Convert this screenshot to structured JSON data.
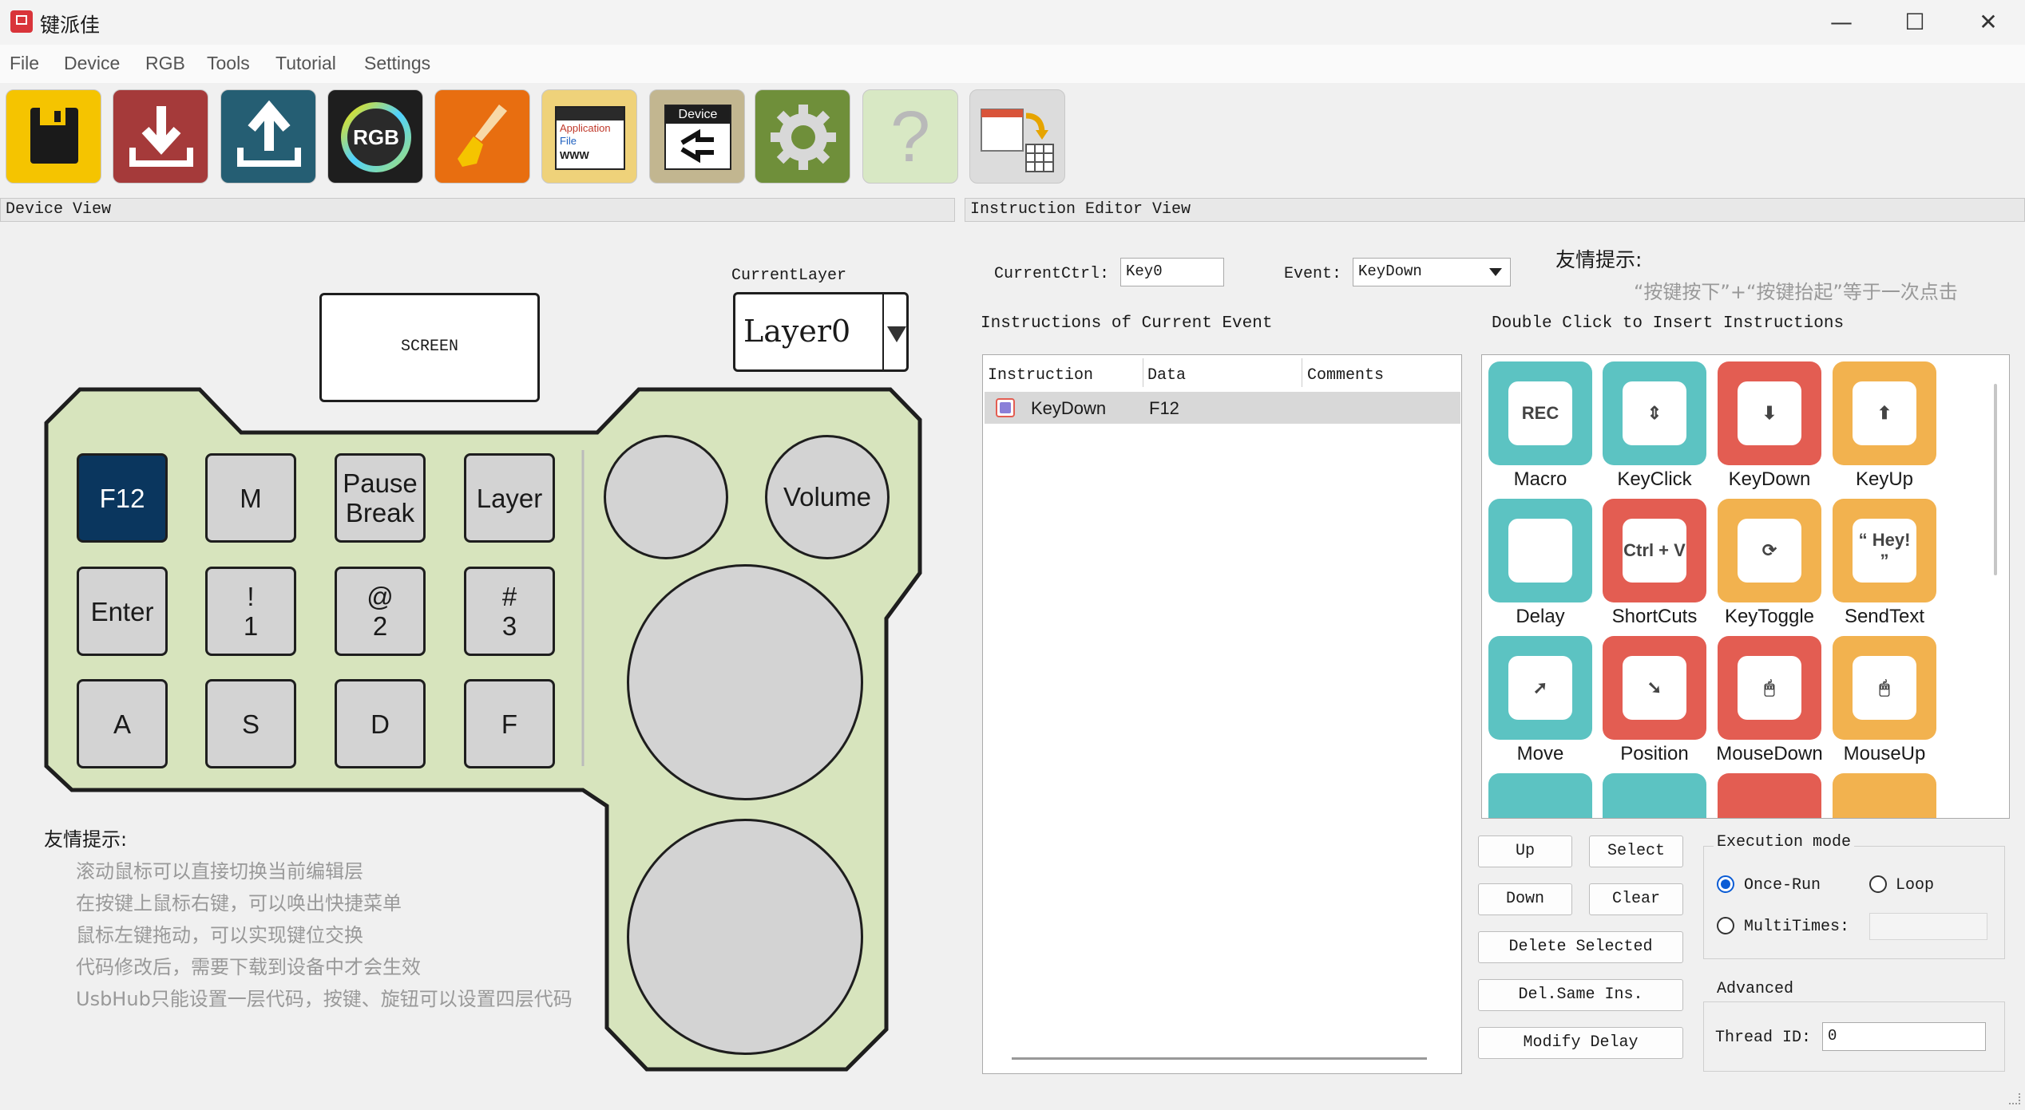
{
  "window": {
    "title": "键派佳",
    "minimize": "—",
    "maximize": "☐",
    "close": "✕"
  },
  "menu": [
    "File",
    "Device",
    "RGB",
    "Tools",
    "Tutorial",
    "Settings"
  ],
  "toolbar": {
    "rgb_label": "RGB",
    "app_icon_text": [
      "Application",
      "File",
      "WWW"
    ],
    "device_label": "Device",
    "help_label": "?",
    "icons": [
      "save-icon",
      "download-icon",
      "upload-icon",
      "rgb-icon",
      "brush-icon",
      "application-icon",
      "device-icon",
      "gear-icon",
      "help-icon",
      "window-icon"
    ]
  },
  "device_view": {
    "header": "Device View",
    "screen_label": "SCREEN",
    "current_layer_label": "CurrentLayer",
    "current_layer_value": "Layer0",
    "keys": [
      "F12",
      "M",
      "Pause\nBreak",
      "Layer",
      "Enter",
      "!\n1",
      "@\n2",
      "#\n3",
      "A",
      "S",
      "D",
      "F"
    ],
    "knob_label": "Volume",
    "tip_title": "友情提示:",
    "tips": [
      "滚动鼠标可以直接切换当前编辑层",
      "在按键上鼠标右键，可以唤出快捷菜单",
      "鼠标左键拖动，可以实现键位交换",
      "代码修改后，需要下载到设备中才会生效",
      "UsbHub只能设置一层代码，按键、旋钮可以设置四层代码"
    ]
  },
  "editor": {
    "header": "Instruction Editor View",
    "current_ctrl_label": "CurrentCtrl:",
    "current_ctrl_value": "Key0",
    "event_label": "Event:",
    "event_value": "KeyDown",
    "tip_title": "友情提示:",
    "tip_text": "“按键按下”+“按键抬起”等于一次点击",
    "instructions_title": "Instructions of Current Event",
    "insert_title": "Double Click to Insert Instructions",
    "columns": [
      "Instruction",
      "Data",
      "Comments"
    ],
    "rows": [
      {
        "instruction": "KeyDown",
        "data": "F12",
        "comments": ""
      }
    ],
    "tiles": [
      {
        "label": "Macro",
        "color": "#5cc3c2",
        "icon": "rec-camera-icon",
        "badge": "REC"
      },
      {
        "label": "KeyClick",
        "color": "#5cc3c2",
        "icon": "key-click-icon",
        "badge": "⇕"
      },
      {
        "label": "KeyDown",
        "color": "#e35d52",
        "icon": "key-down-icon",
        "badge": "⬇"
      },
      {
        "label": "KeyUp",
        "color": "#f2b24f",
        "icon": "key-up-icon",
        "badge": "⬆"
      },
      {
        "label": "Delay",
        "color": "#5cc3c2",
        "icon": "clock-icon",
        "badge": ""
      },
      {
        "label": "ShortCuts",
        "color": "#e35d52",
        "icon": "shortcut-icon",
        "badge": "Ctrl + V"
      },
      {
        "label": "KeyToggle",
        "color": "#f2b24f",
        "icon": "toggle-icon",
        "badge": "⟳"
      },
      {
        "label": "SendText",
        "color": "#f2b24f",
        "icon": "speech-icon",
        "badge": "“ Hey! ”"
      },
      {
        "label": "Move",
        "color": "#5cc3c2",
        "icon": "move-cursor-icon",
        "badge": "➚"
      },
      {
        "label": "Position",
        "color": "#e35d52",
        "icon": "position-cursor-icon",
        "badge": "➘"
      },
      {
        "label": "MouseDown",
        "color": "#e35d52",
        "icon": "mouse-down-icon",
        "badge": "🖱"
      },
      {
        "label": "MouseUp",
        "color": "#f2b24f",
        "icon": "mouse-up-icon",
        "badge": "🖱"
      }
    ],
    "partial_tiles": [
      "#5cc3c2",
      "#5cc3c2",
      "#e35d52",
      "#f2b24f"
    ],
    "buttons": {
      "up": "Up",
      "select": "Select",
      "down": "Down",
      "clear": "Clear",
      "delete_selected": "Delete Selected",
      "del_same": "Del.Same Ins.",
      "modify_delay": "Modify Delay"
    },
    "execution": {
      "title": "Execution mode",
      "once_run": "Once-Run",
      "loop": "Loop",
      "multitimes": "MultiTimes:",
      "selected": "Once-Run"
    },
    "advanced": {
      "title": "Advanced",
      "thread_label": "Thread ID:",
      "thread_value": "0"
    }
  }
}
